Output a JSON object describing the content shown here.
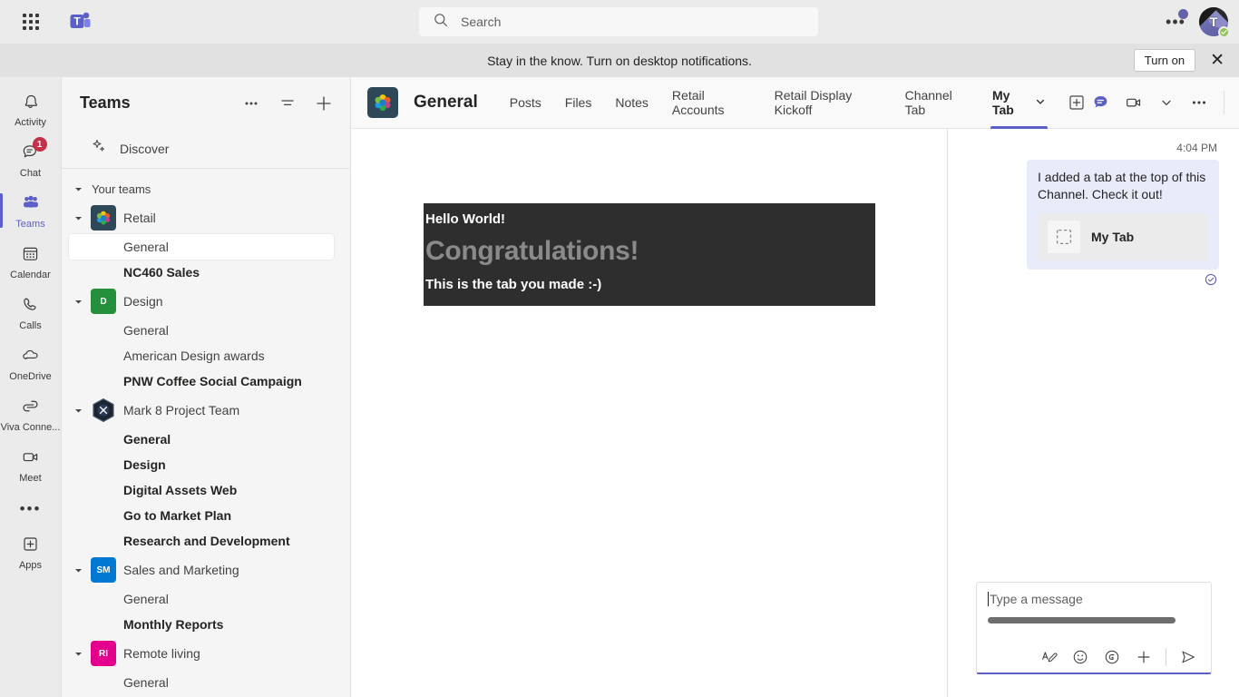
{
  "titlebar": {
    "app_launcher": "app-launcher",
    "app_logo": "microsoft-teams-logo",
    "search_placeholder": "Search",
    "search_value": "",
    "more_label": "•••",
    "avatar_initial": "T",
    "presence": "available"
  },
  "banner": {
    "text": "Stay in the know. Turn on desktop notifications.",
    "button": "Turn on",
    "close": "✕"
  },
  "rail": {
    "items": [
      {
        "label": "Activity",
        "icon": "bell-icon",
        "badge": "",
        "active": false
      },
      {
        "label": "Chat",
        "icon": "chat-icon",
        "badge": "1",
        "active": false
      },
      {
        "label": "Teams",
        "icon": "teams-people-icon",
        "badge": "",
        "active": true
      },
      {
        "label": "Calendar",
        "icon": "calendar-icon",
        "badge": "",
        "active": false
      },
      {
        "label": "Calls",
        "icon": "phone-icon",
        "badge": "",
        "active": false
      },
      {
        "label": "OneDrive",
        "icon": "cloud-icon",
        "badge": "",
        "active": false
      },
      {
        "label": "Viva Conne...",
        "icon": "viva-connections-icon",
        "badge": "",
        "active": false
      },
      {
        "label": "Meet",
        "icon": "video-camera-icon",
        "badge": "",
        "active": false
      }
    ],
    "more": "•••",
    "apps": {
      "label": "Apps",
      "icon": "apps-plus-icon"
    }
  },
  "sidebar": {
    "title": "Teams",
    "actions": [
      {
        "name": "more-options-icon",
        "glyph": "•••"
      },
      {
        "name": "filter-icon",
        "glyph": "filter"
      },
      {
        "name": "join-or-create-team-icon",
        "glyph": "plus"
      }
    ],
    "discover": "Discover",
    "your_teams_label": "Your teams",
    "teams": [
      {
        "name": "Retail",
        "avatar_type": "image",
        "avatar_color": "#2f4858",
        "initials": "",
        "expanded": true,
        "channels": [
          {
            "name": "General",
            "unread": false,
            "selected": true
          },
          {
            "name": "NC460 Sales",
            "unread": true,
            "selected": false
          }
        ]
      },
      {
        "name": "Design",
        "avatar_type": "initials",
        "avatar_color": "#25903b",
        "initials": "D",
        "expanded": true,
        "channels": [
          {
            "name": "General",
            "unread": false,
            "selected": false
          },
          {
            "name": "American Design awards",
            "unread": false,
            "selected": false
          },
          {
            "name": "PNW Coffee Social Campaign",
            "unread": true,
            "selected": false
          }
        ]
      },
      {
        "name": "Mark 8 Project Team",
        "avatar_type": "hex",
        "avatar_color": "#1f2937",
        "initials": "",
        "expanded": true,
        "channels": [
          {
            "name": "General",
            "unread": true,
            "selected": false
          },
          {
            "name": "Design",
            "unread": true,
            "selected": false
          },
          {
            "name": "Digital Assets Web",
            "unread": true,
            "selected": false
          },
          {
            "name": "Go to Market Plan",
            "unread": true,
            "selected": false
          },
          {
            "name": "Research and Development",
            "unread": true,
            "selected": false
          }
        ]
      },
      {
        "name": "Sales and Marketing",
        "avatar_type": "initials",
        "avatar_color": "#0078d4",
        "initials": "SM",
        "expanded": true,
        "channels": [
          {
            "name": "General",
            "unread": false,
            "selected": false
          },
          {
            "name": "Monthly Reports",
            "unread": true,
            "selected": false
          }
        ]
      },
      {
        "name": "Remote living",
        "avatar_type": "initials",
        "avatar_color": "#e3008c",
        "initials": "RI",
        "expanded": true,
        "channels": [
          {
            "name": "General",
            "unread": false,
            "selected": false
          }
        ]
      }
    ]
  },
  "channel_header": {
    "channel_name": "General",
    "tabs": [
      {
        "label": "Posts",
        "active": false,
        "chevron": false
      },
      {
        "label": "Files",
        "active": false,
        "chevron": false
      },
      {
        "label": "Notes",
        "active": false,
        "chevron": false
      },
      {
        "label": "Retail Accounts",
        "active": false,
        "chevron": false
      },
      {
        "label": "Retail Display Kickoff",
        "active": false,
        "chevron": false
      },
      {
        "label": "Channel Tab",
        "active": false,
        "chevron": false
      },
      {
        "label": "My Tab",
        "active": true,
        "chevron": true
      }
    ],
    "add_tab": "+",
    "right_icons": [
      {
        "name": "conversation-icon"
      },
      {
        "name": "video-camera-icon"
      },
      {
        "name": "chevron-down-icon"
      },
      {
        "name": "more-options-icon"
      }
    ]
  },
  "tab_content": {
    "heading": "Hello World!",
    "congrats": "Congratulations!",
    "subtext": "This is the tab you made :-)",
    "bg_color": "#2e2e2e",
    "congrats_color": "#8a8a8a"
  },
  "chat_panel": {
    "message": {
      "time": "4:04 PM",
      "text": "I added a tab at the top of this Channel. Check it out!",
      "card_title": "My Tab",
      "card_icon": "dashed-square-icon",
      "status_icon": "seen-check-icon",
      "bubble_color": "#e8ebfa"
    },
    "compose": {
      "placeholder": "Type a message",
      "value": "",
      "actions": [
        {
          "name": "format-icon"
        },
        {
          "name": "emoji-icon"
        },
        {
          "name": "giphy-icon"
        },
        {
          "name": "add-attachment-icon"
        },
        {
          "name": "send-icon"
        }
      ]
    }
  },
  "colors": {
    "accent": "#5b5fc7",
    "brand": "#6264a7",
    "badge_red": "#c4314b",
    "presence_green": "#92c353"
  }
}
